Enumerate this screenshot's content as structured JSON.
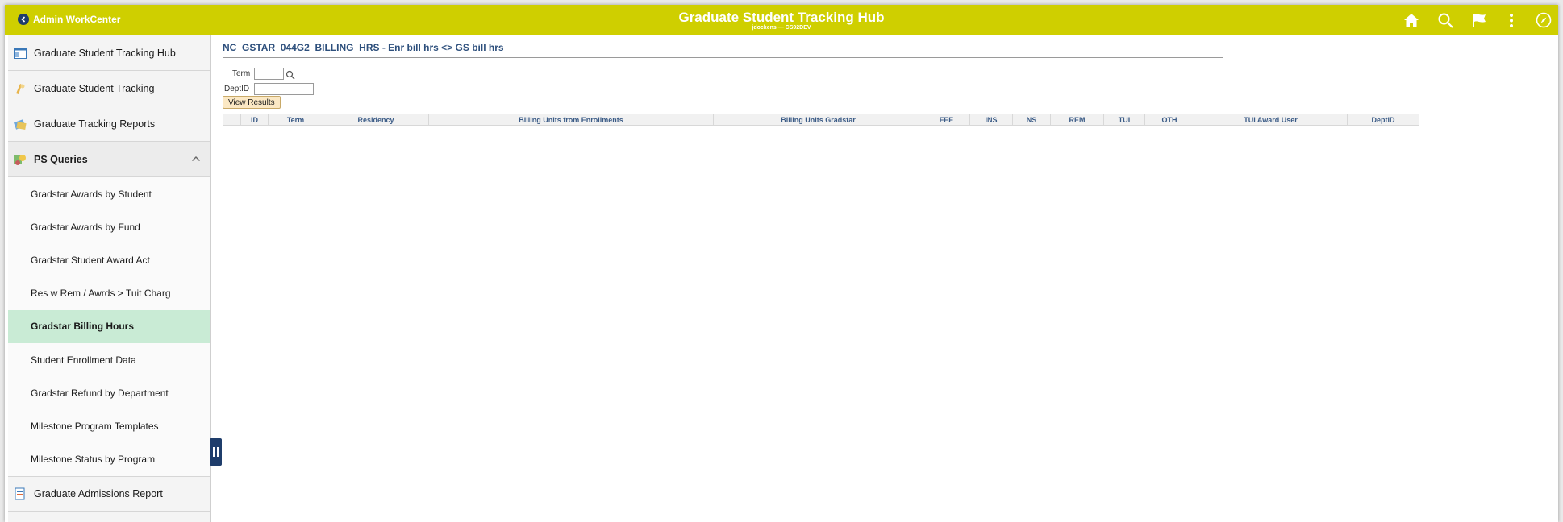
{
  "header": {
    "back_label": "Admin WorkCenter",
    "title": "Graduate Student Tracking Hub",
    "subtitle": "jdockens — CS92DEV",
    "accent_color": "#cfcf00",
    "icons": [
      "home-icon",
      "search-icon",
      "flag-icon",
      "more-icon",
      "navbar-icon"
    ]
  },
  "sidebar": {
    "items": [
      {
        "label": "Graduate Student Tracking Hub",
        "icon": "hub-icon"
      },
      {
        "label": "Graduate Student Tracking",
        "icon": "tracking-icon"
      },
      {
        "label": "Graduate Tracking Reports",
        "icon": "reports-icon"
      }
    ],
    "group": {
      "label": "PS Queries",
      "icon": "queries-icon",
      "expanded": true
    },
    "sub_items": [
      {
        "label": "Gradstar Awards by Student"
      },
      {
        "label": "Gradstar Awards by Fund"
      },
      {
        "label": "Gradstar Student Award Act"
      },
      {
        "label": "Res w Rem / Awrds > Tuit Charg"
      },
      {
        "label": "Gradstar Billing Hours",
        "active": true
      },
      {
        "label": "Student Enrollment Data"
      },
      {
        "label": "Gradstar Refund by Department"
      },
      {
        "label": "Milestone Program Templates"
      },
      {
        "label": "Milestone Status by Program"
      }
    ],
    "bottom_item": {
      "label": "Graduate Admissions Report",
      "icon": "admissions-icon"
    }
  },
  "main": {
    "heading": "NC_GSTAR_044G2_BILLING_HRS - Enr bill hrs <> GS bill hrs",
    "term_label": "Term",
    "term_value": "",
    "deptid_label": "DeptID",
    "deptid_value": "",
    "view_results_label": "View Results",
    "columns": [
      "",
      "ID",
      "Term",
      "Residency",
      "Billing Units from Enrollments",
      "Billing Units Gradstar",
      "FEE",
      "INS",
      "NS",
      "REM",
      "TUI",
      "OTH",
      "TUI Award User",
      "DeptID"
    ]
  }
}
